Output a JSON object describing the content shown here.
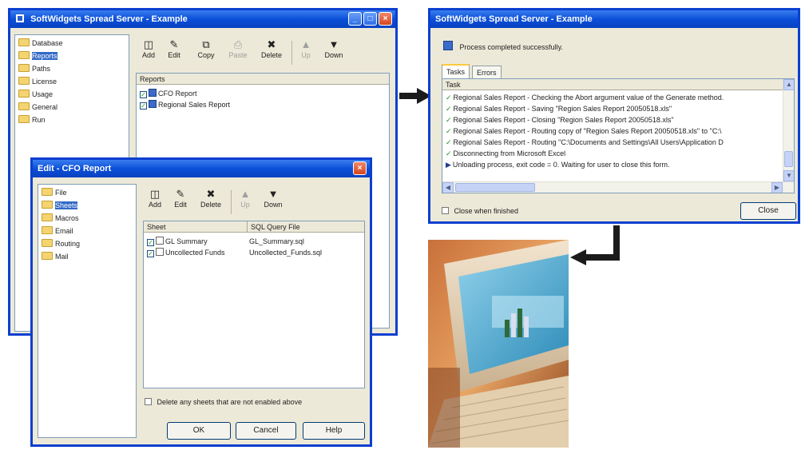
{
  "main_window": {
    "title": "SoftWidgets Spread Server - Example",
    "tree": [
      {
        "label": "Database",
        "selected": false
      },
      {
        "label": "Reports",
        "selected": true
      },
      {
        "label": "Paths",
        "selected": false
      },
      {
        "label": "License",
        "selected": false
      },
      {
        "label": "Usage",
        "selected": false
      },
      {
        "label": "General",
        "selected": false
      },
      {
        "label": "Run",
        "selected": false
      }
    ],
    "toolbar": {
      "add": "Add",
      "edit": "Edit",
      "copy": "Copy",
      "paste": "Paste",
      "delete": "Delete",
      "up": "Up",
      "down": "Down"
    },
    "list_header": "Reports",
    "reports": [
      "CFO Report",
      "Regional Sales Report"
    ]
  },
  "edit_dialog": {
    "title": "Edit - CFO Report",
    "tree": [
      {
        "label": "File",
        "selected": false
      },
      {
        "label": "Sheets",
        "selected": true
      },
      {
        "label": "Macros",
        "selected": false
      },
      {
        "label": "Email",
        "selected": false
      },
      {
        "label": "Routing",
        "selected": false
      },
      {
        "label": "Mail",
        "selected": false
      }
    ],
    "toolbar": {
      "add": "Add",
      "edit": "Edit",
      "delete": "Delete",
      "up": "Up",
      "down": "Down"
    },
    "columns": {
      "sheet": "Sheet",
      "query": "SQL Query File"
    },
    "sheets": [
      {
        "sheet": "GL Summary",
        "query": "GL_Summary.sql"
      },
      {
        "sheet": "Uncollected Funds",
        "query": "Uncollected_Funds.sql"
      }
    ],
    "delete_checkbox_label": "Delete any sheets that are not enabled above",
    "buttons": {
      "ok": "OK",
      "cancel": "Cancel",
      "help": "Help"
    }
  },
  "progress_window": {
    "title": "SoftWidgets Spread Server - Example",
    "status": "Process completed successfully.",
    "tabs": {
      "tasks": "Tasks",
      "errors": "Errors"
    },
    "list_header": "Task",
    "tasks": [
      "Regional Sales Report - Checking the Abort argument value of the Generate method.",
      "Regional Sales Report - Saving \"Region Sales Report 20050518.xls\"",
      "Regional Sales Report - Closing \"Region Sales Report 20050518.xls\"",
      "Regional Sales Report - Routing copy of \"Region Sales Report 20050518.xls\" to \"C:\\",
      "Regional Sales Report - Routing \"C:\\Documents and Settings\\All Users\\Application D",
      "Disconnecting from Microsoft Excel",
      "Unloading process, exit code = 0. Waiting for user to close this form."
    ],
    "close_when_finished_label": "Close when finished",
    "close_button": "Close"
  },
  "colors": {
    "title_blue": "#0b4fd8",
    "selection": "#316ac5",
    "window_bg": "#ece9d8"
  }
}
